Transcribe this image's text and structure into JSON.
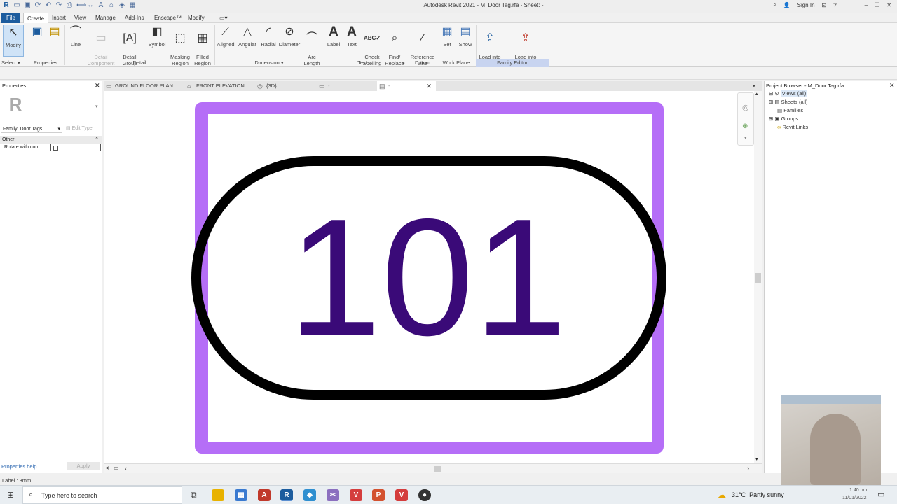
{
  "app": {
    "title": "Autodesk Revit 2021 - M_Door Tag.rfa - Sheet: -",
    "sign_in": "Sign In"
  },
  "menu": {
    "tabs": [
      "File",
      "Create",
      "Insert",
      "View",
      "Manage",
      "Add-Ins",
      "Enscape™",
      "Modify"
    ],
    "active": "Create"
  },
  "ribbon": {
    "modify": "Modify",
    "line": "Line",
    "detail_component": "Detail\nComponent",
    "detail_group": "Detail\nGroup",
    "symbol": "Symbol",
    "masking_region": "Masking\nRegion",
    "filled_region": "Filled\nRegion",
    "aligned": "Aligned",
    "angular": "Angular",
    "radial": "Radial",
    "diameter": "Diameter",
    "arc_length": "Arc\nLength",
    "label": "Label",
    "text": "Text",
    "check_spelling": "Check\nSpelling",
    "find_replace": "Find/\nReplace",
    "reference_line": "Reference\nLine",
    "set": "Set",
    "show": "Show",
    "load_into_project": "Load into\nProject",
    "load_into_project_close": "Load into\nProject and Close",
    "panels": {
      "select": "Select",
      "properties": "Properties",
      "detail": "Detail",
      "dimension": "Dimension",
      "text": "Text",
      "datum": "Datum",
      "work_plane": "Work Plane",
      "family_editor": "Family Editor"
    }
  },
  "properties": {
    "title": "Properties",
    "family_selector": "Family: Door Tags",
    "edit_type": "Edit Type",
    "group": "Other",
    "param_name": "Rotate with com...",
    "help": "Properties help",
    "apply": "Apply"
  },
  "tabs": [
    {
      "label": "GROUND FLOOR PLAN"
    },
    {
      "label": "FRONT ELEVATION"
    },
    {
      "label": "{3D}"
    },
    {
      "label": "-"
    },
    {
      "label": "-"
    }
  ],
  "tag": {
    "number": "101",
    "outline_color": "#000000",
    "text_color": "#3a0a78",
    "sheet_border_color": "#b56ef7"
  },
  "browser": {
    "title": "Project Browser - M_Door Tag.rfa",
    "items": [
      "Views (all)",
      "Sheets (all)",
      "Families",
      "Groups",
      "Revit Links"
    ]
  },
  "status": {
    "text": "Label : 3mm"
  },
  "taskbar": {
    "search_placeholder": "Type here to search",
    "weather": "31°C  Partly sunny",
    "time": "1:40 pm",
    "date": "11/01/2022"
  }
}
